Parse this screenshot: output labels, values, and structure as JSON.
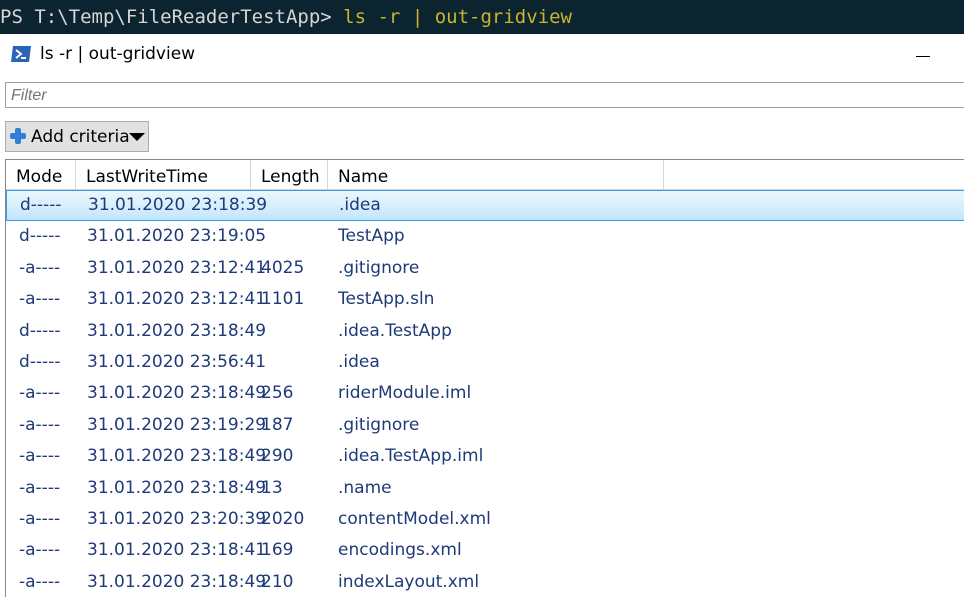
{
  "terminal": {
    "prompt": "PS T:\\Temp\\FileReaderTestApp> ",
    "command": "ls -r",
    "pipe": " | ",
    "command2": "out-gridview"
  },
  "window": {
    "title": "ls -r | out-gridview"
  },
  "filter": {
    "placeholder": "Filter",
    "value": ""
  },
  "add_criteria": {
    "label": "Add criteria"
  },
  "grid": {
    "columns": [
      "Mode",
      "LastWriteTime",
      "Length",
      "Name"
    ],
    "selected_row": 0,
    "rows": [
      {
        "mode": "d-----",
        "time": "31.01.2020 23:18:39",
        "length": "",
        "name": ".idea"
      },
      {
        "mode": "d-----",
        "time": "31.01.2020 23:19:05",
        "length": "",
        "name": "TestApp"
      },
      {
        "mode": "-a----",
        "time": "31.01.2020 23:12:41",
        "length": "4025",
        "name": ".gitignore"
      },
      {
        "mode": "-a----",
        "time": "31.01.2020 23:12:41",
        "length": "1101",
        "name": "TestApp.sln"
      },
      {
        "mode": "d-----",
        "time": "31.01.2020 23:18:49",
        "length": "",
        "name": ".idea.TestApp"
      },
      {
        "mode": "d-----",
        "time": "31.01.2020 23:56:41",
        "length": "",
        "name": ".idea"
      },
      {
        "mode": "-a----",
        "time": "31.01.2020 23:18:49",
        "length": "256",
        "name": "riderModule.iml"
      },
      {
        "mode": "-a----",
        "time": "31.01.2020 23:19:29",
        "length": "187",
        "name": ".gitignore"
      },
      {
        "mode": "-a----",
        "time": "31.01.2020 23:18:49",
        "length": "290",
        "name": ".idea.TestApp.iml"
      },
      {
        "mode": "-a----",
        "time": "31.01.2020 23:18:49",
        "length": "13",
        "name": ".name"
      },
      {
        "mode": "-a----",
        "time": "31.01.2020 23:20:39",
        "length": "2020",
        "name": "contentModel.xml"
      },
      {
        "mode": "-a----",
        "time": "31.01.2020 23:18:41",
        "length": "169",
        "name": "encodings.xml"
      },
      {
        "mode": "-a----",
        "time": "31.01.2020 23:18:49",
        "length": "210",
        "name": "indexLayout.xml"
      }
    ]
  },
  "colors": {
    "terminal_bg": "#0c2430",
    "terminal_accent": "#c8b62a",
    "row_text": "#1e3a78",
    "selection_border": "#3c9ae3"
  },
  "icons": {
    "window": "powershell-icon",
    "add": "plus-icon",
    "dropdown": "triangle-down-icon"
  }
}
